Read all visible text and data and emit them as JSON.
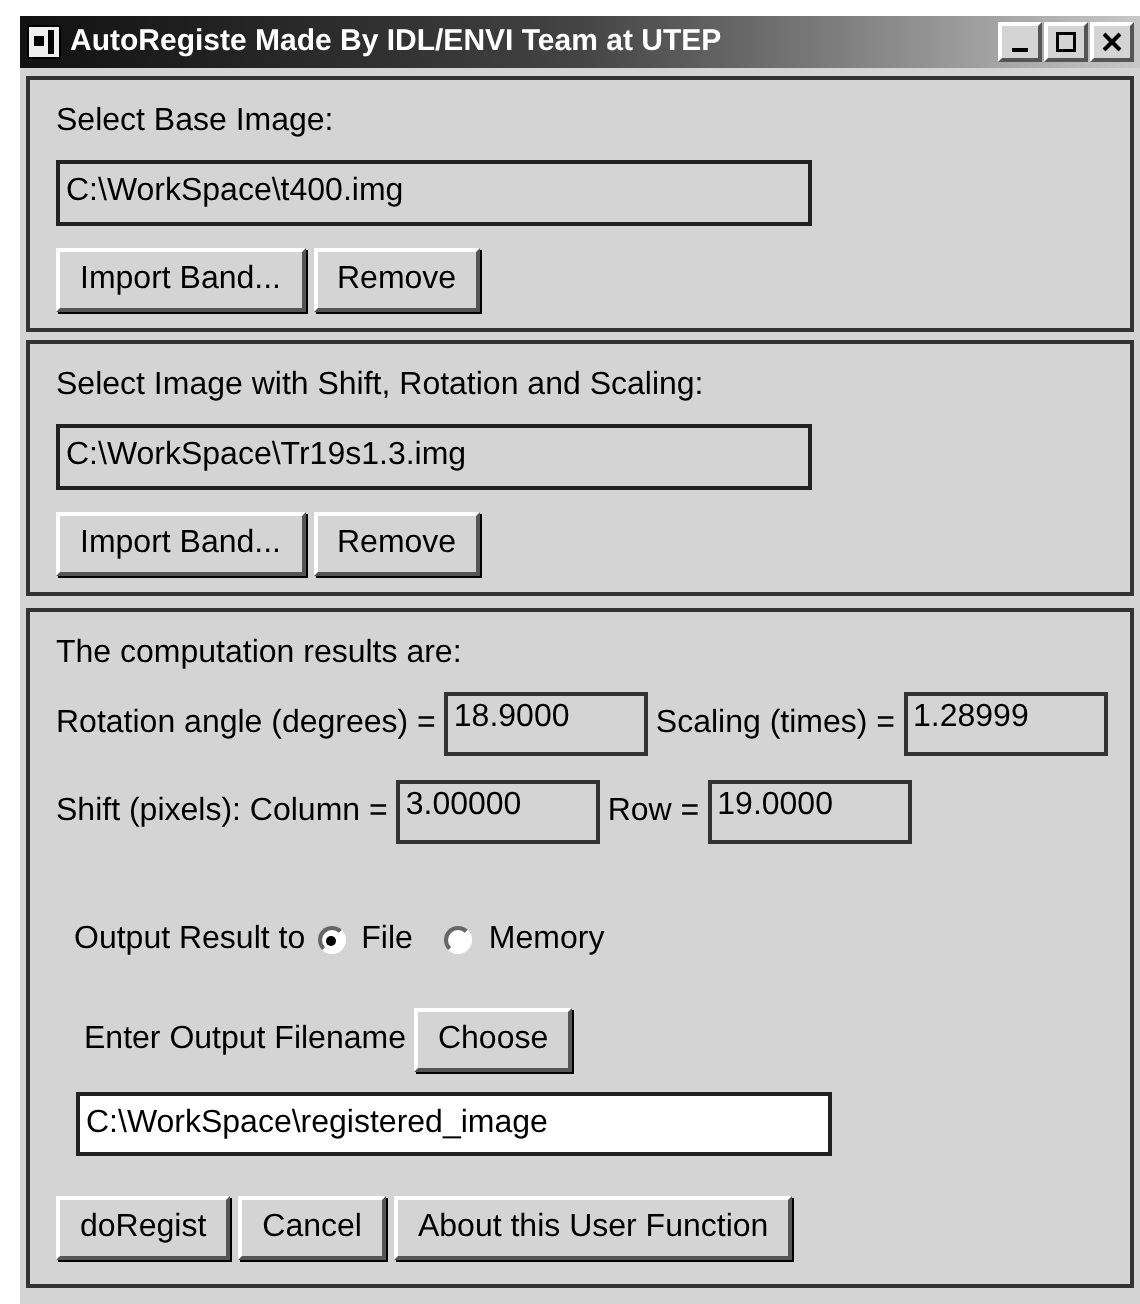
{
  "window": {
    "title": "AutoRegiste Made By IDL/ENVI Team at UTEP"
  },
  "base_image": {
    "label": "Select Base Image:",
    "path": "C:\\WorkSpace\\t400.img",
    "buttons": [
      "Import Band...",
      "Remove"
    ]
  },
  "warp_image": {
    "label": "Select Image with Shift, Rotation and Scaling:",
    "path": "C:\\WorkSpace\\Tr19s1.3.img",
    "buttons": [
      "Import Band...",
      "Remove"
    ]
  },
  "results": {
    "heading": "The computation results are:",
    "rows": [
      [
        {
          "label": "Rotation angle (degrees) =",
          "value": "18.9000"
        },
        {
          "label": "Scaling (times) =",
          "value": "1.28999"
        }
      ],
      [
        {
          "label": "Shift (pixels): Column =",
          "value": "3.00000"
        },
        {
          "label": "Row =",
          "value": "19.0000"
        }
      ]
    ],
    "output_label": "Output Result to",
    "output_options": [
      {
        "label": "File",
        "selected": true
      },
      {
        "label": "Memory",
        "selected": false
      }
    ],
    "filename_label": "Enter Output Filename",
    "choose_button": "Choose",
    "filename": "C:\\WorkSpace\\registered_image",
    "buttons": [
      "doRegist",
      "Cancel",
      "About this User Function"
    ]
  }
}
